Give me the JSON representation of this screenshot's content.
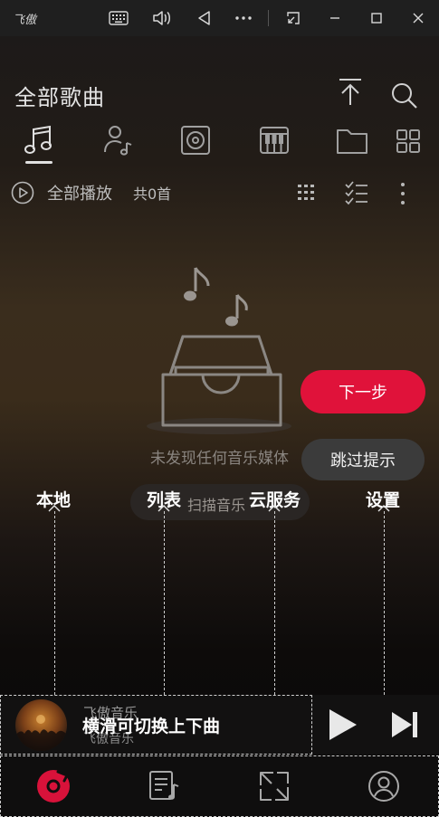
{
  "titlebar": {
    "app_logo": "飞傲",
    "icons": [
      "keyboard-icon",
      "volume-icon",
      "back-icon",
      "more-icon",
      "screen-capture-icon",
      "minimize-icon",
      "maximize-icon",
      "close-icon"
    ]
  },
  "header": {
    "title": "全部歌曲"
  },
  "tabs": [
    {
      "name": "songs",
      "icon": "music-note-icon",
      "active": true
    },
    {
      "name": "artists",
      "icon": "artist-icon",
      "active": false
    },
    {
      "name": "albums",
      "icon": "album-icon",
      "active": false
    },
    {
      "name": "genres",
      "icon": "piano-icon",
      "active": false
    },
    {
      "name": "folders",
      "icon": "folder-icon",
      "active": false
    },
    {
      "name": "more",
      "icon": "grid-icon",
      "active": false
    }
  ],
  "playall": {
    "label": "全部播放",
    "count": "共0首"
  },
  "empty": {
    "text": "未发现任何音乐媒体",
    "scan_label": "扫描音乐"
  },
  "guide": {
    "next_label": "下一步",
    "skip_label": "跳过提示",
    "labels": [
      "本地",
      "列表",
      "云服务",
      "设置"
    ],
    "swipe_hint": "横滑可切换上下曲"
  },
  "player": {
    "title": "飞傲音乐",
    "artist": "飞傲音乐"
  },
  "colors": {
    "accent": "#e0123a",
    "background": "#141214"
  }
}
